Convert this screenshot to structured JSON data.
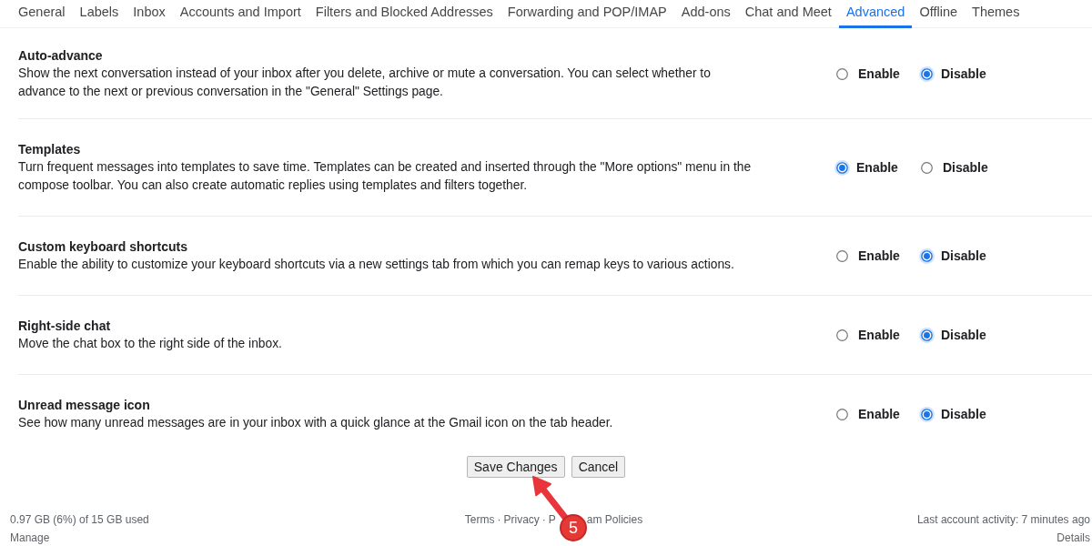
{
  "tabs": [
    {
      "label": "General",
      "selected": false
    },
    {
      "label": "Labels",
      "selected": false
    },
    {
      "label": "Inbox",
      "selected": false
    },
    {
      "label": "Accounts and Import",
      "selected": false
    },
    {
      "label": "Filters and Blocked Addresses",
      "selected": false
    },
    {
      "label": "Forwarding and POP/IMAP",
      "selected": false
    },
    {
      "label": "Add-ons",
      "selected": false
    },
    {
      "label": "Chat and Meet",
      "selected": false
    },
    {
      "label": "Advanced",
      "selected": true
    },
    {
      "label": "Offline",
      "selected": false
    },
    {
      "label": "Themes",
      "selected": false
    }
  ],
  "settings": [
    {
      "title": "Auto-advance",
      "description": "Show the next conversation instead of your inbox after you delete, archive or mute a conversation. You can select whether to advance to the next or previous conversation in the \"General\" Settings page.",
      "options": [
        {
          "label": "Enable",
          "selected": false
        },
        {
          "label": "Disable",
          "selected": true
        }
      ]
    },
    {
      "title": "Templates",
      "description": "Turn frequent messages into templates to save time. Templates can be created and inserted through the \"More options\" menu in the compose toolbar. You can also create automatic replies using templates and filters together.",
      "options": [
        {
          "label": "Enable",
          "selected": true
        },
        {
          "label": "Disable",
          "selected": false
        }
      ]
    },
    {
      "title": "Custom keyboard shortcuts",
      "description": "Enable the ability to customize your keyboard shortcuts via a new settings tab from which you can remap keys to various actions.",
      "options": [
        {
          "label": "Enable",
          "selected": false
        },
        {
          "label": "Disable",
          "selected": true
        }
      ]
    },
    {
      "title": "Right-side chat",
      "description": "Move the chat box to the right side of the inbox.",
      "options": [
        {
          "label": "Enable",
          "selected": false
        },
        {
          "label": "Disable",
          "selected": true
        }
      ]
    },
    {
      "title": "Unread message icon",
      "description": "See how many unread messages are in your inbox with a quick glance at the Gmail icon on the tab header.",
      "options": [
        {
          "label": "Enable",
          "selected": false
        },
        {
          "label": "Disable",
          "selected": true
        }
      ]
    }
  ],
  "buttons": [
    "Save Changes",
    "Cancel"
  ],
  "footer": {
    "storage": "0.97 GB (6%) of 15 GB used",
    "manage": "Manage",
    "links": [
      {
        "text": "Terms",
        "separator": "·"
      },
      {
        "text": "Privacy",
        "separator": "·"
      },
      {
        "text": "P"
      },
      {
        "text": "am Policies"
      }
    ],
    "activity": "Last account activity: 7 minutes ago",
    "details": "Details"
  },
  "annotation": {
    "step": "5"
  }
}
